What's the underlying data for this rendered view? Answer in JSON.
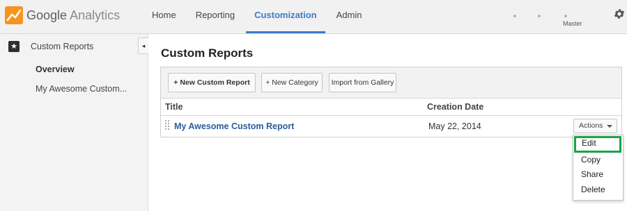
{
  "app": {
    "logo_brand": "Google",
    "logo_product": "Analytics",
    "brand_colors": {
      "orange": "#f7931e",
      "accent": "#3b7cc9",
      "highlight": "#1aa34a"
    }
  },
  "nav": {
    "items": [
      {
        "label": "Home",
        "active": false
      },
      {
        "label": "Reporting",
        "active": false
      },
      {
        "label": "Customization",
        "active": true
      },
      {
        "label": "Admin",
        "active": false
      }
    ],
    "account_label": "Master"
  },
  "sidebar": {
    "section_label": "Custom Reports",
    "section_icon": "star-icon",
    "items": [
      {
        "label": "Overview",
        "active": true
      },
      {
        "label": "My Awesome Custom...",
        "active": false
      }
    ]
  },
  "main": {
    "title": "Custom Reports",
    "toolbar": {
      "new_report": "+ New Custom Report",
      "new_category": "+ New Category",
      "import_gallery": "Import from Gallery"
    },
    "table": {
      "columns": [
        "Title",
        "Creation Date"
      ],
      "rows": [
        {
          "title": "My Awesome Custom Report",
          "date": "May 22, 2014",
          "actions_label": "Actions"
        }
      ]
    }
  },
  "dropdown": {
    "items": [
      "Edit",
      "Copy",
      "Share",
      "Delete"
    ],
    "highlighted": "Edit"
  }
}
